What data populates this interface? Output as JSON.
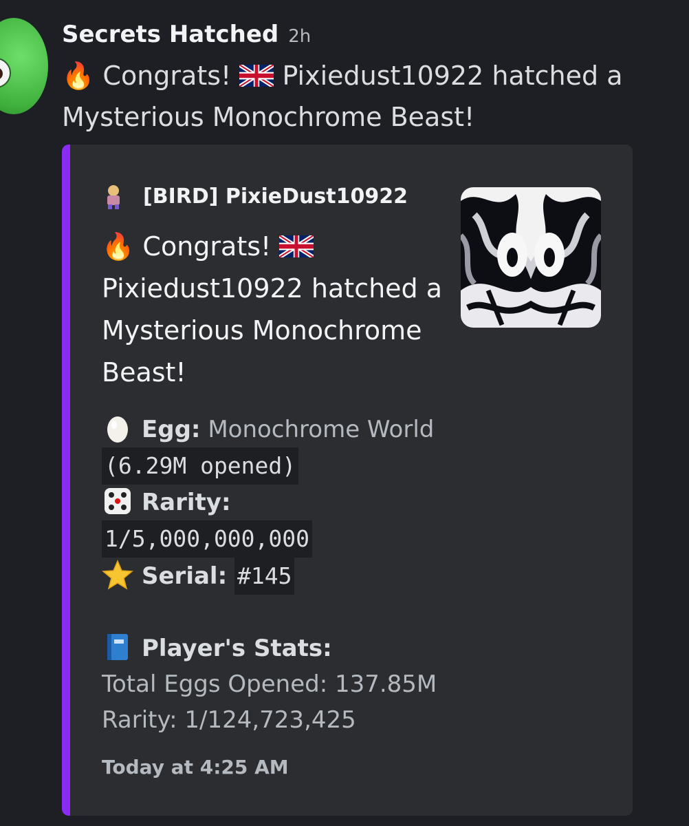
{
  "message": {
    "author": "Secrets Hatched",
    "timestamp": "2h",
    "text_prefix": "Congrats!",
    "text_rest": "Pixiedust10922 hatched a Mysterious Monochrome Beast!"
  },
  "embed": {
    "accent_color": "#8b2cf5",
    "author_name": "[BIRD] PixieDust10922",
    "description_prefix": "Congrats!",
    "description_rest": "Pixiedust10922 hatched a Mysterious Monochrome Beast!",
    "fields": {
      "egg_label": "Egg:",
      "egg_value": "Monochrome World",
      "egg_opened": "(6.29M opened)",
      "rarity_label": "Rarity:",
      "rarity_value": "1/5,000,000,000",
      "serial_label": "Serial:",
      "serial_value": "#145",
      "stats_label": "Player's Stats:",
      "total_eggs": "Total Eggs Opened: 137.85M",
      "player_rarity": "Rarity: 1/124,723,425"
    },
    "footer": "Today at 4:25 AM"
  },
  "icons": [
    "fire-icon",
    "uk-flag-icon",
    "egg-icon",
    "dice-icon",
    "star-icon",
    "book-icon"
  ]
}
